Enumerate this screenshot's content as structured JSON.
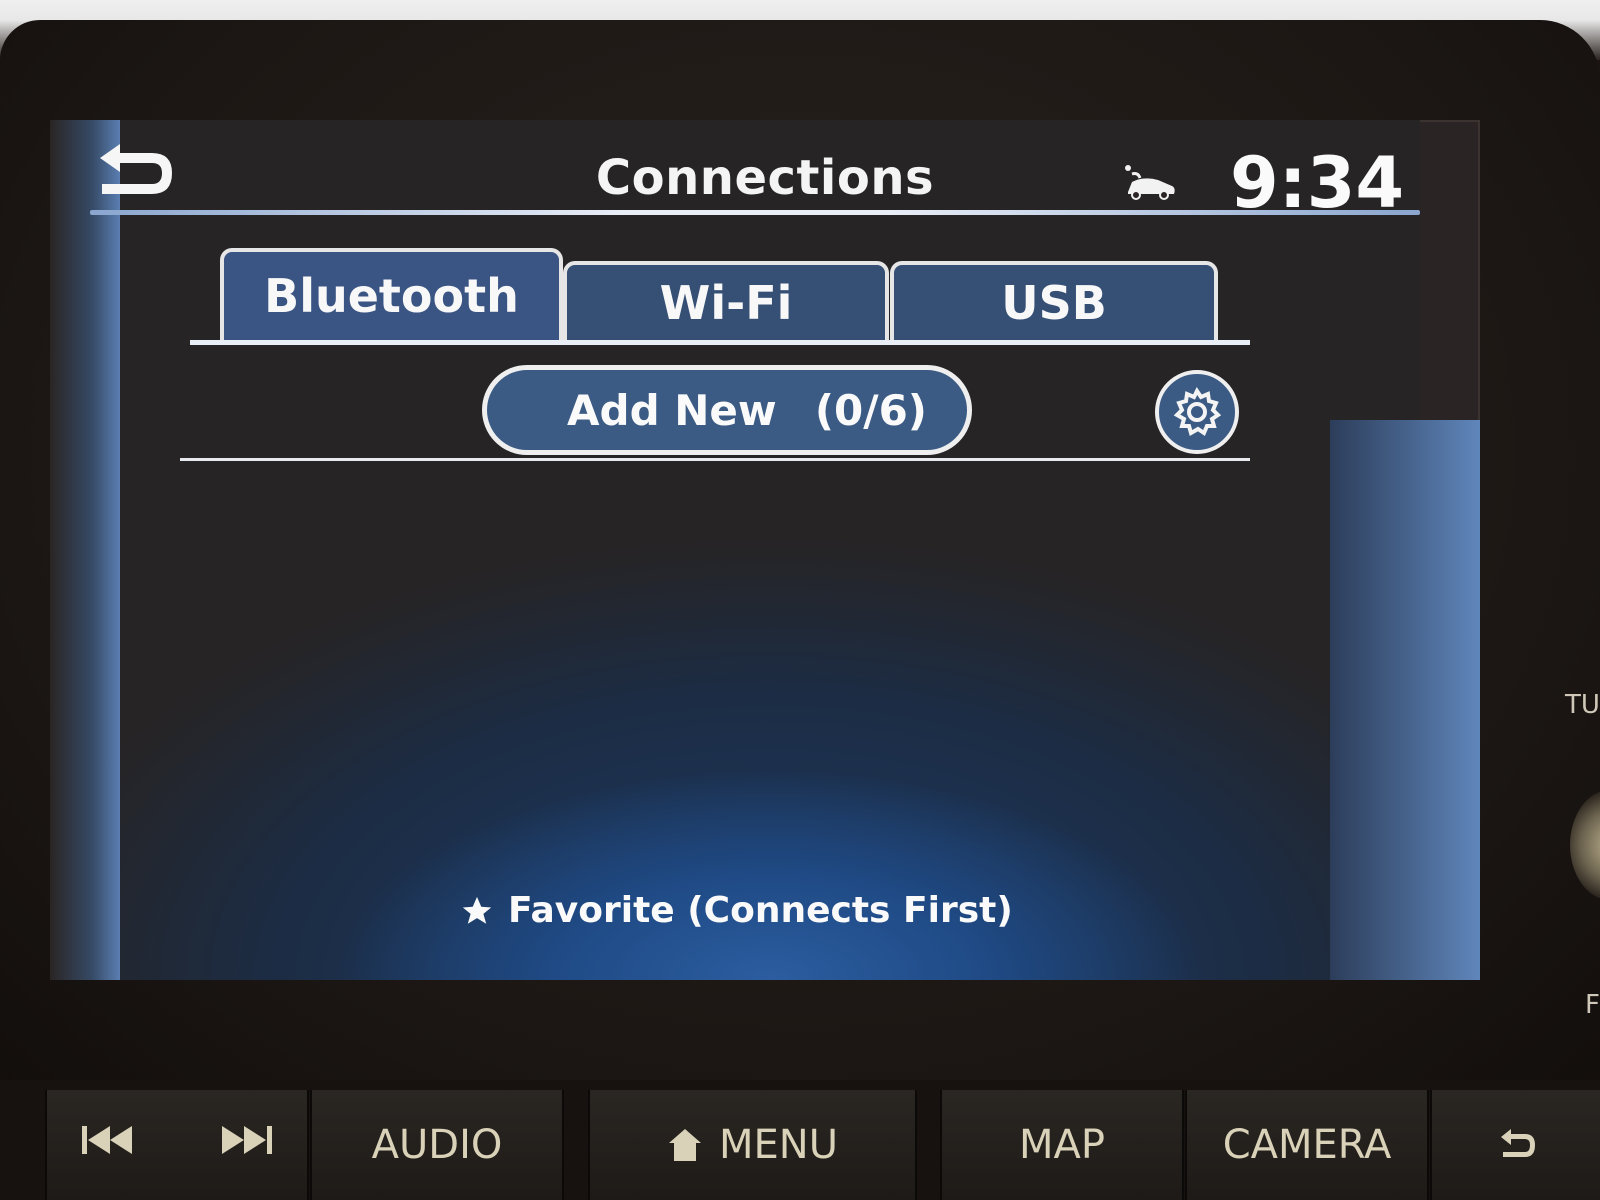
{
  "screen": {
    "header": {
      "back_icon": "u-turn-back-arrow-icon",
      "title": "Connections",
      "status_icon": "connected-car-icon",
      "clock": "9:34"
    },
    "tabs": [
      {
        "label": "Bluetooth",
        "active": true
      },
      {
        "label": "Wi-Fi",
        "active": false
      },
      {
        "label": "USB",
        "active": false
      }
    ],
    "add_new": {
      "label": "Add New",
      "count": "(0/6)"
    },
    "settings_icon": "gear-icon",
    "footer_note": {
      "icon": "star-icon",
      "text": "Favorite (Connects First)"
    }
  },
  "hardware_buttons": {
    "prev_icon": "skip-previous-icon",
    "next_icon": "skip-next-icon",
    "audio": "AUDIO",
    "menu_icon": "home-icon",
    "menu": "MENU",
    "map": "MAP",
    "camera": "CAMERA",
    "back_icon": "back-arrow-icon"
  },
  "side_labels": {
    "tune": "TU",
    "bottom": "F"
  },
  "colors": {
    "tab_fill": "#364f75",
    "button_fill": "#3b5b84",
    "text": "#fafafa",
    "hw_text": "#d9d2b8"
  }
}
